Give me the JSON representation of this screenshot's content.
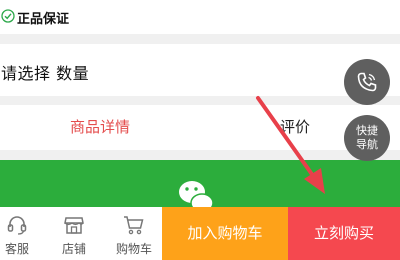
{
  "guarantee": {
    "label": "正品保证"
  },
  "spec": {
    "label": "请选择 数量"
  },
  "tabs": [
    {
      "label": "商品详情",
      "active": true
    },
    {
      "label": "评价",
      "active": false
    }
  ],
  "floating": {
    "phone_icon": "phone-icon",
    "nav_label": "快捷\n导航"
  },
  "bottom_nav": [
    {
      "label": "客服",
      "icon": "headset-icon"
    },
    {
      "label": "店铺",
      "icon": "store-icon"
    },
    {
      "label": "购物车",
      "icon": "cart-icon"
    }
  ],
  "actions": {
    "add_to_cart": "加入购物车",
    "buy_now": "立刻购买"
  },
  "colors": {
    "active_tab": "#e44d4d",
    "banner": "#2cad3c",
    "add_to_cart": "#fea219",
    "buy_now": "#f5484f",
    "annotation_arrow": "#e8404a"
  }
}
